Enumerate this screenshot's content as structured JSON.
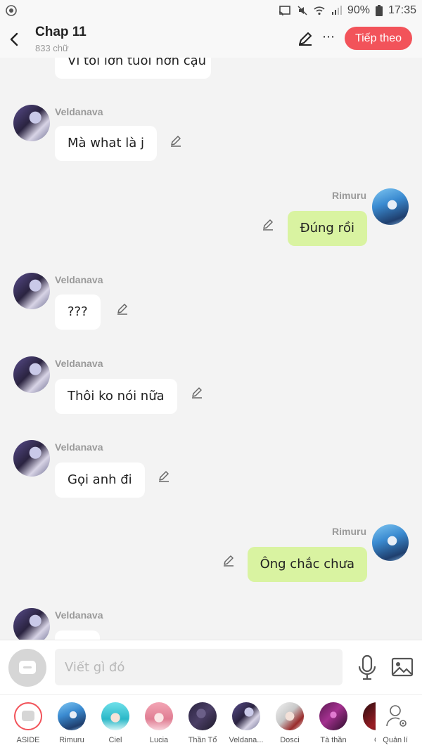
{
  "status_bar": {
    "battery": "90%",
    "time": "17:35"
  },
  "header": {
    "title": "Chap 11",
    "word_count": "833 chữ",
    "next_button": "Tiếp theo"
  },
  "messages": [
    {
      "side": "left",
      "sender": "",
      "text": "Vì tôi lớn tuổi hơn cậu",
      "avatar": "veldanava"
    },
    {
      "side": "left",
      "sender": "Veldanava",
      "text": "Mà what là j",
      "avatar": "veldanava"
    },
    {
      "side": "right",
      "sender": "Rimuru",
      "text": "Đúng rồi",
      "avatar": "rimuru"
    },
    {
      "side": "left",
      "sender": "Veldanava",
      "text": "???",
      "avatar": "veldanava"
    },
    {
      "side": "left",
      "sender": "Veldanava",
      "text": "Thôi ko nói nữa",
      "avatar": "veldanava"
    },
    {
      "side": "left",
      "sender": "Veldanava",
      "text": "Gọi anh đi",
      "avatar": "veldanava"
    },
    {
      "side": "right",
      "sender": "Rimuru",
      "text": "Ông chắc chưa",
      "avatar": "rimuru"
    },
    {
      "side": "left",
      "sender": "Veldanava",
      "text": "",
      "avatar": "veldanava"
    }
  ],
  "composer": {
    "placeholder": "Viết gì đó"
  },
  "characters": [
    {
      "name": "ASIDE"
    },
    {
      "name": "Rimuru"
    },
    {
      "name": "Ciel"
    },
    {
      "name": "Lucia"
    },
    {
      "name": "Thần Tổ"
    },
    {
      "name": "Veldana..."
    },
    {
      "name": "Dosci"
    },
    {
      "name": "Tà thần"
    },
    {
      "name": "C"
    }
  ],
  "manage_label": "Quản lí",
  "colors": {
    "accent": "#f2535a",
    "right_bubble": "#d9f3a1",
    "left_bubble": "#ffffff",
    "background": "#f3f3f3"
  }
}
